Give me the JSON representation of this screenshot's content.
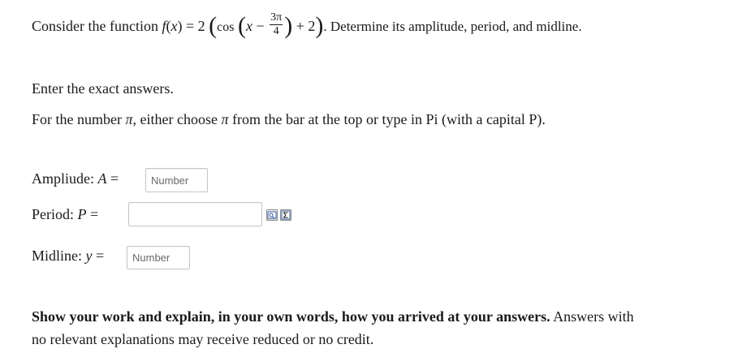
{
  "question": {
    "intro": "Consider the function",
    "func_name": "f",
    "func_var": "x",
    "eq_sign": "=",
    "coef": "2",
    "cos": "cos",
    "var_x": "x",
    "minus": "−",
    "frac_num": "3π",
    "frac_den": "4",
    "plus_two": "+ 2",
    "tail": ". Determine its amplitude, period, and midline."
  },
  "instructions": {
    "line1": "Enter the exact answers.",
    "line2_a": "For the number",
    "line2_pi1": "π",
    "line2_b": ", either choose",
    "line2_pi2": "π",
    "line2_c": "from the bar at the top or type in Pi (with a capital P)."
  },
  "fields": {
    "amplitude": {
      "label": "Ampliude:",
      "var": "A",
      "eq": "=",
      "placeholder": "Number",
      "value": ""
    },
    "period": {
      "label": "Period:",
      "var": "P",
      "eq": "=",
      "placeholder": "",
      "value": ""
    },
    "midline": {
      "label": "Midline:",
      "var": "y",
      "eq": "=",
      "placeholder": "Number",
      "value": ""
    }
  },
  "tools": {
    "preview_icon": "preview-icon",
    "sigma_icon": "sigma-icon"
  },
  "footer": {
    "bold": "Show your work and explain, in your own words, how you arrived at your answers.",
    "rest_line1": "Answers with",
    "line2": "no relevant explanations may receive reduced or no credit."
  }
}
